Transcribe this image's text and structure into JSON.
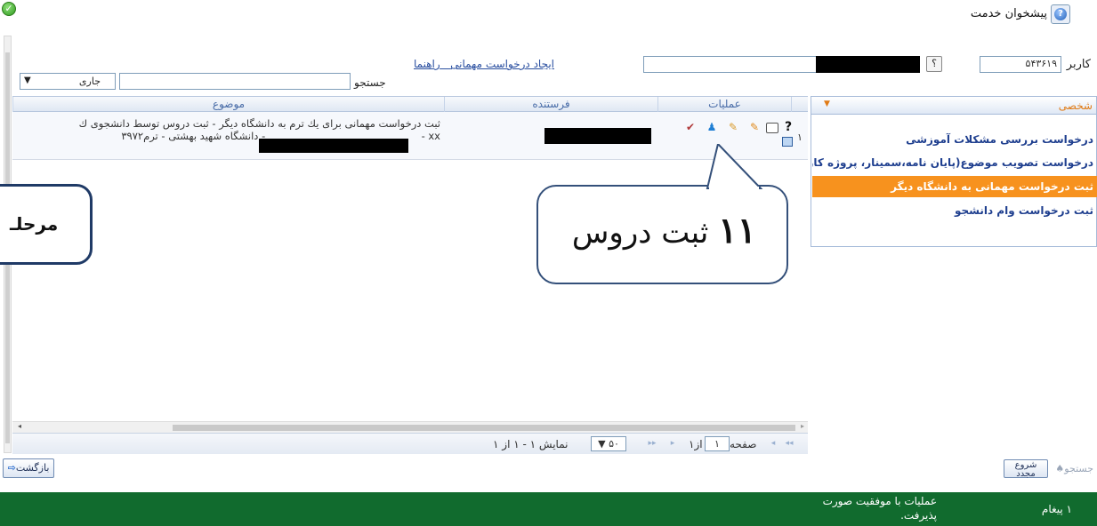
{
  "header": {
    "service_title": "پیشخوان خدمت",
    "service_icon": "question-circle-icon",
    "ok_icon": "check-circle-icon"
  },
  "filter": {
    "user_label": "کاربر",
    "user_value": "۵۴۳۶۱۹",
    "q_button": "؟",
    "link_create": "ایجاد درخواست مهمانی",
    "link_help": "راهنما"
  },
  "search": {
    "label": "جستجو",
    "select_value": "جاری"
  },
  "grid": {
    "columns": {
      "subject": "موضوع",
      "sender": "فرستنده",
      "ops": "عملیات"
    },
    "rows": [
      {
        "index": "۱",
        "subject_line1": "ثبت درخواست مهمانی برای یك ترم به دانشگاه دیگر - ثبت دروس توسط دانشجوی ك",
        "subject_line2_pre": "xx -",
        "subject_line2_post": "- دانشگاه شهید بهشتی - ترم۳۹۷۲"
      }
    ]
  },
  "pager": {
    "page_label": "صفحه",
    "page_value": "۱",
    "of_label": "از۱",
    "page_size": "۵۰",
    "display_text": "نمایش ۱ - ۱ از ۱"
  },
  "sidebar": {
    "title": "شخصی",
    "items": [
      {
        "label": "درخواست بررسی مشكلات آموزشی"
      },
      {
        "label": "درخواست تصویب موضوع(پایان نامه،سمینار، پروژه كارشناسی"
      },
      {
        "label": "ثبت درخواست مهمانی به دانشگاه دیگر"
      },
      {
        "label": "ثبت درخواست وام دانشجو"
      }
    ]
  },
  "buttons": {
    "back": "بازگشت",
    "search": "جستجو",
    "restart_line1": "شروع",
    "restart_line2": "مجدد"
  },
  "status": {
    "count": "۱ پیغام",
    "message": "عملیات با موفقیت صورت پذیرفت."
  },
  "callouts": {
    "step_num": "۱۱",
    "step_text": "ثبت دروس",
    "stage_text": "مرحلـ"
  },
  "colors": {
    "accent": "#f7921e",
    "status_bg": "#116b2e",
    "link": "#2a4fa0",
    "header_text": "#4a6da8"
  }
}
